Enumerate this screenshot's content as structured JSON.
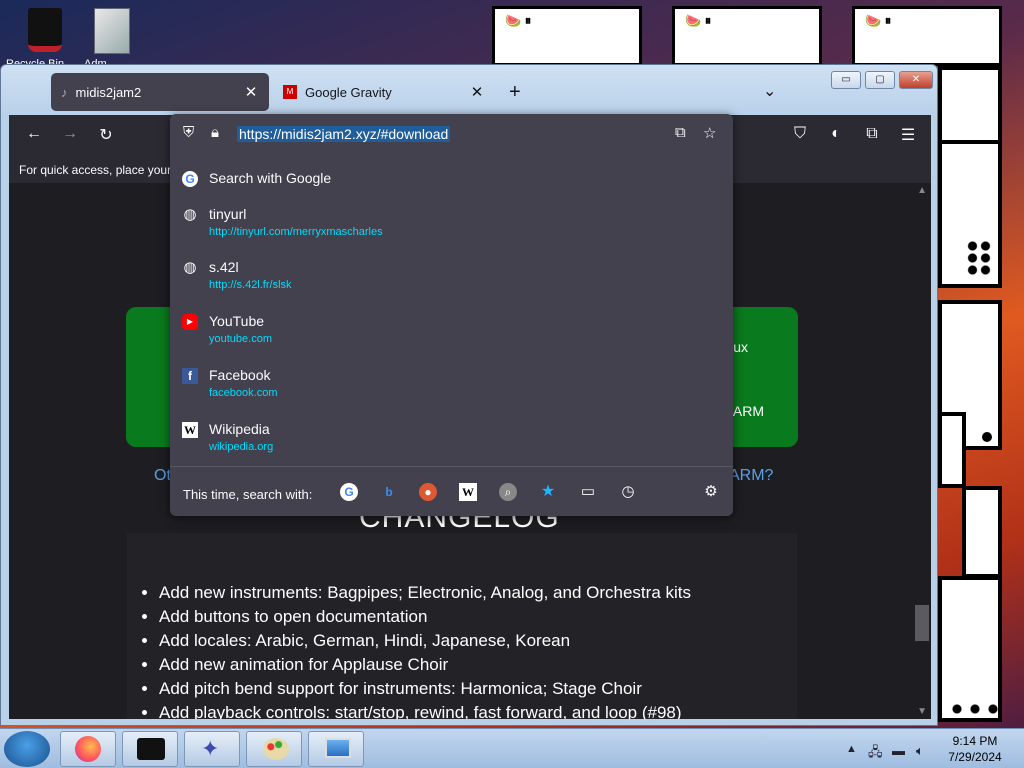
{
  "desktop": {
    "icons": [
      {
        "label": "Recycle Bin",
        "name": "recycle-bin"
      },
      {
        "label": "Adm...",
        "name": "admin-folder"
      }
    ]
  },
  "browser": {
    "tabs": [
      {
        "title": "midis2jam2",
        "active": true
      },
      {
        "title": "Google Gravity",
        "active": false
      }
    ],
    "new_tab_label": "+",
    "tab_list_label": "⌄",
    "window_controls": {
      "minimize": "▭",
      "maximize": "▢",
      "close": "✕"
    },
    "toolbar": {
      "back": "←",
      "forward": "→",
      "reload": "↻"
    },
    "bookmarks_hint": "For quick access, place your b",
    "url": "https://midis2jam2.xyz/#download"
  },
  "dropdown": {
    "results": [
      {
        "title": "Search with Google",
        "url": "",
        "icon": "google-icon"
      },
      {
        "title": "tinyurl",
        "url": "http://tinyurl.com/merryxmascharles",
        "icon": "globe-icon"
      },
      {
        "title": "s.42l",
        "url": "http://s.42l.fr/slsk",
        "icon": "globe-icon"
      },
      {
        "title": "YouTube",
        "url": "youtube.com",
        "icon": "youtube-icon"
      },
      {
        "title": "Facebook",
        "url": "facebook.com",
        "icon": "facebook-icon"
      },
      {
        "title": "Wikipedia",
        "url": "wikipedia.org",
        "icon": "wikipedia-icon"
      }
    ],
    "one_off_label": "This time, search with:",
    "engines": [
      "google-icon",
      "bing-icon",
      "duckduckgo-icon",
      "wikipedia-icon",
      "search-icon",
      "bookmarks-icon",
      "tabs-icon",
      "history-icon"
    ]
  },
  "page": {
    "green_box_right_top": "ux",
    "green_box_right_bottom": "ARM",
    "other_link_left": "Ot",
    "other_link_right": "ARM?",
    "changelog_heading": "CHANGELOG",
    "changelog": [
      "Add new instruments: Bagpipes; Electronic, Analog, and Orchestra kits",
      "Add buttons to open documentation",
      "Add locales: Arabic, German, Hindi, Japanese, Korean",
      "Add new animation for Applause Choir",
      "Add pitch bend support for instruments: Harmonica; Stage Choir",
      "Add playback controls: start/stop, rewind, fast forward, and loop (#98)"
    ]
  },
  "taskbar": {
    "time": "9:14 PM",
    "date": "7/29/2024"
  }
}
